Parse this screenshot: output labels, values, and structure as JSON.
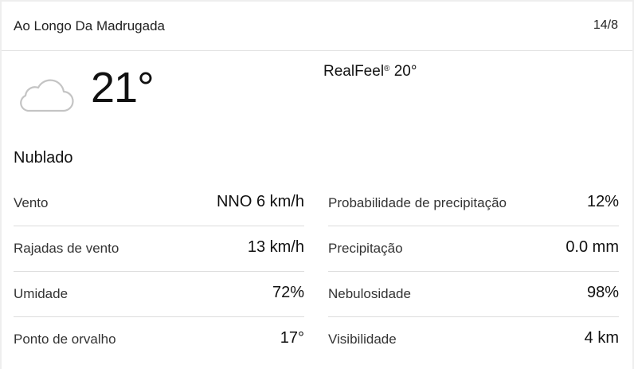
{
  "header": {
    "title": "Ao Longo Da Madrugada",
    "date": "14/8"
  },
  "current": {
    "icon": "cloud-icon",
    "temperature": "21°",
    "realfeel_label": "RealFeel",
    "realfeel_mark": "®",
    "realfeel_value": "20°",
    "phrase": "Nublado"
  },
  "details": {
    "left": [
      {
        "label": "Vento",
        "value": "NNO 6 km/h"
      },
      {
        "label": "Rajadas de vento",
        "value": "13 km/h"
      },
      {
        "label": "Umidade",
        "value": "72%"
      },
      {
        "label": "Ponto de orvalho",
        "value": "17°"
      }
    ],
    "right": [
      {
        "label": "Probabilidade de precipitação",
        "value": "12%"
      },
      {
        "label": "Precipitação",
        "value": "0.0 mm"
      },
      {
        "label": "Nebulosidade",
        "value": "98%"
      },
      {
        "label": "Visibilidade",
        "value": "4 km"
      }
    ]
  },
  "colors": {
    "background": "#eeeeee",
    "card": "#ffffff",
    "divider": "#dddddd",
    "icon_stroke": "#c4c4c4"
  }
}
